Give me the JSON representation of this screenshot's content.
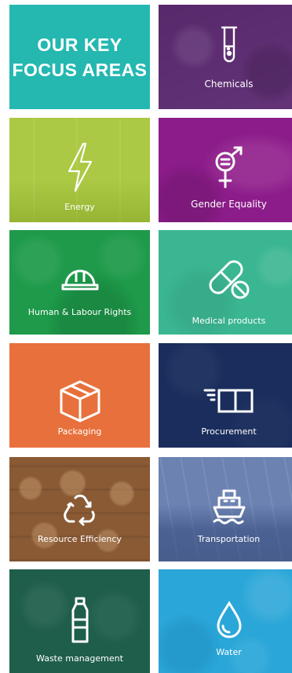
{
  "header": {
    "title_line1": "OUR KEY",
    "title_line2": "FOCUS AREAS"
  },
  "colors": {
    "title_bg": "#25b8b1",
    "chemicals": "#5e2c73",
    "energy": "#a7c63a",
    "gender_equality": "#8c1c8a",
    "human_labour_rights": "#1e9a4a",
    "medical_products": "#3bb692",
    "packaging": "#e8703c",
    "procurement": "#1a2d5c",
    "resource_efficiency": "#8a5a35",
    "transportation": "#5872a8",
    "waste_management": "#1f5e4b",
    "water": "#2aa6d8"
  },
  "tiles": [
    {
      "label": "Chemicals",
      "icon": "test-tube-icon"
    },
    {
      "label": "Energy",
      "icon": "lightning-bolt-icon"
    },
    {
      "label": "Gender Equality",
      "icon": "gender-symbol-icon"
    },
    {
      "label": "Human & Labour Rights",
      "icon": "hard-hat-icon"
    },
    {
      "label": "Medical products",
      "icon": "pill-capsule-icon"
    },
    {
      "label": "Packaging",
      "icon": "box-icon"
    },
    {
      "label": "Procurement",
      "icon": "procurement-book-icon"
    },
    {
      "label": "Resource Efficiency",
      "icon": "recycle-icon"
    },
    {
      "label": "Transportation",
      "icon": "ship-icon"
    },
    {
      "label": "Waste management",
      "icon": "bottle-icon"
    },
    {
      "label": "Water",
      "icon": "water-drop-icon"
    }
  ]
}
